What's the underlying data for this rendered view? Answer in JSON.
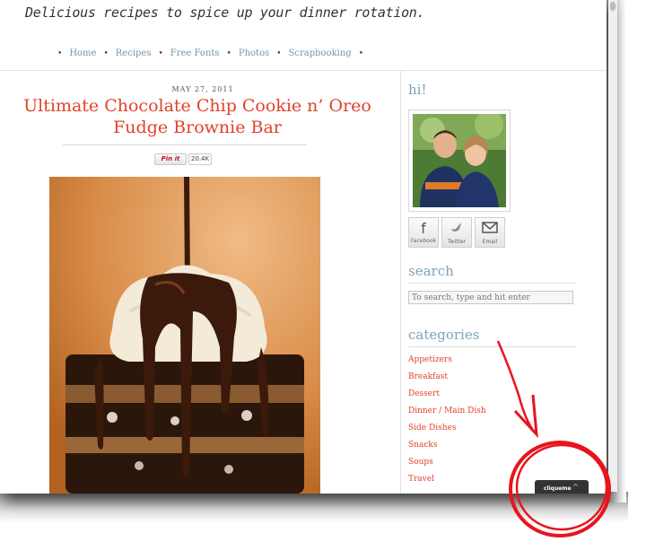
{
  "header": {
    "tagline": "Delicious recipes to spice up your dinner rotation."
  },
  "nav": {
    "items": [
      "Home",
      "Recipes",
      "Free Fonts",
      "Photos",
      "Scrapbooking"
    ]
  },
  "post": {
    "date": "MAY 27, 2011",
    "title": "Ultimate Chocolate Chip Cookie n’ Oreo Fudge Brownie Bar",
    "pin_label": "Pin it",
    "pin_count": "20.4K"
  },
  "sidebar": {
    "greeting": "hi!",
    "social": [
      {
        "label": "Facebook",
        "icon": "facebook-icon"
      },
      {
        "label": "Twitter",
        "icon": "twitter-bird-icon"
      },
      {
        "label": "Email",
        "icon": "envelope-icon"
      }
    ],
    "search_heading": "search",
    "search_placeholder": "To search, type and hit enter",
    "categories_heading": "categories",
    "categories": [
      "Appetizers",
      "Breakfast",
      "Dessert",
      "Dinner / Main Dish",
      "Side Dishes",
      "Snacks",
      "Soups",
      "Travel"
    ]
  },
  "widget": {
    "label": "cliqueme"
  },
  "colors": {
    "accent_red": "#e2412a",
    "heading_blue": "#7fa2b4",
    "annotation_red": "#e8141c"
  }
}
